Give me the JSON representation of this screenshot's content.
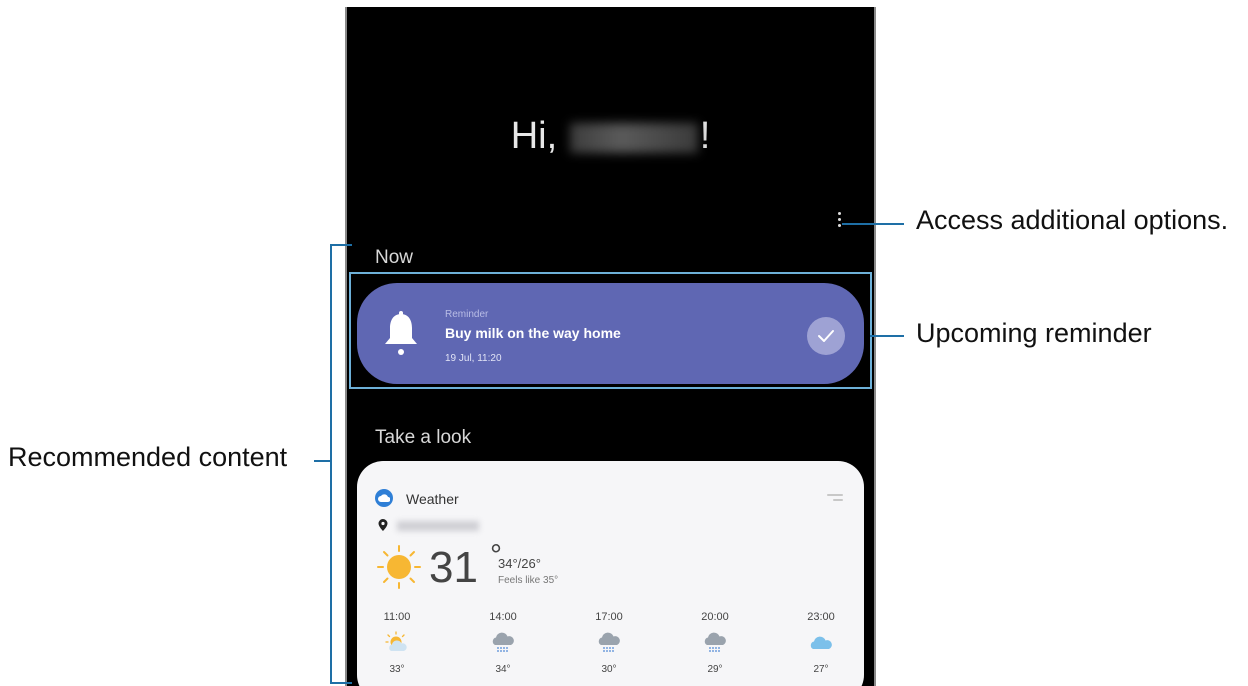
{
  "screen": {
    "greeting_prefix": "Hi,",
    "greeting_suffix": "!",
    "now_label": "Now",
    "reminder": {
      "category": "Reminder",
      "title": "Buy milk on the way home",
      "time": "19 Jul, 11:20"
    },
    "look_label": "Take a look",
    "weather": {
      "app_label": "Weather",
      "current_temp": "31",
      "degree_symbol": "°",
      "hi_lo": "34°/26°",
      "feels_like": "Feels like 35°",
      "hourly": [
        {
          "time": "11:00",
          "icon": "sun-cloud-icon",
          "temp": "33°"
        },
        {
          "time": "14:00",
          "icon": "rain-cloud-icon",
          "temp": "34°"
        },
        {
          "time": "17:00",
          "icon": "rain-cloud-icon",
          "temp": "30°"
        },
        {
          "time": "20:00",
          "icon": "rain-cloud-icon",
          "temp": "29°"
        },
        {
          "time": "23:00",
          "icon": "cloud-icon",
          "temp": "27°"
        }
      ]
    }
  },
  "callouts": {
    "options": "Access additional options.",
    "reminder": "Upcoming reminder",
    "recommended": "Recommended content"
  },
  "colors": {
    "reminder_card": "#5f67b3",
    "callout_line": "#1e6fa6",
    "highlight_frame": "#6db0d8"
  }
}
